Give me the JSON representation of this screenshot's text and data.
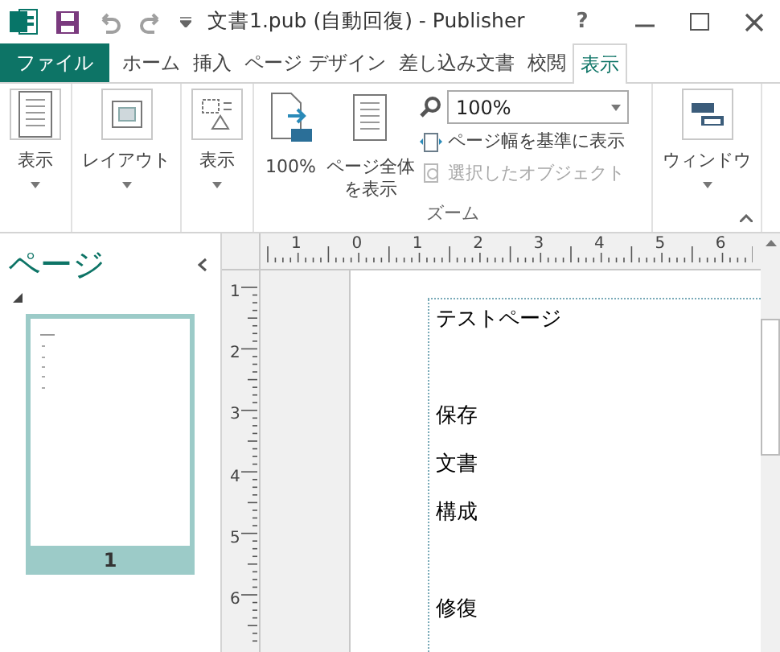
{
  "title_bar": {
    "title": "文書1.pub (自動回復) - Publisher",
    "quick_access": [
      {
        "kind": "save",
        "disabled": false
      },
      {
        "kind": "undo",
        "disabled": true
      },
      {
        "kind": "redo",
        "disabled": true
      }
    ],
    "help": "?"
  },
  "tabs": [
    {
      "label": "ファイル",
      "kind": "file",
      "selected": false
    },
    {
      "label": "ホーム",
      "kind": "tab",
      "selected": false
    },
    {
      "label": "挿入",
      "kind": "tab",
      "selected": false
    },
    {
      "label": "ページ デザイン",
      "kind": "tab",
      "selected": false
    },
    {
      "label": "差し込み文書",
      "kind": "tab",
      "selected": false
    },
    {
      "label": "校閲",
      "kind": "tab",
      "selected": false
    },
    {
      "label": "表示",
      "kind": "tab",
      "selected": true
    }
  ],
  "ribbon": {
    "groups": [
      {
        "buttons": [
          {
            "label": "表示",
            "kind": "page"
          }
        ]
      },
      {
        "buttons": [
          {
            "label": "レイアウト",
            "kind": "picture"
          }
        ]
      },
      {
        "buttons": [
          {
            "label": "表示",
            "kind": "shapes"
          }
        ]
      },
      {
        "label": "ズーム",
        "zoom": {
          "value": "100%",
          "large": [
            {
              "label": "100%",
              "kind": "hundred"
            },
            {
              "label": "ページ全体を表示",
              "kind": "page"
            }
          ],
          "small": [
            {
              "label": "ページ幅を基準に表示",
              "disabled": false
            },
            {
              "label": "選択したオブジェクト",
              "disabled": true
            }
          ]
        }
      },
      {
        "buttons": [
          {
            "label": "ウィンドウ",
            "kind": "windows"
          }
        ]
      }
    ]
  },
  "page_pane": {
    "title": "ページ",
    "pages": [
      {
        "number": "1",
        "selected": true
      }
    ]
  },
  "horizontal_ruler": [
    "1",
    "0",
    "1",
    "2",
    "3",
    "4",
    "5",
    "6"
  ],
  "vertical_ruler": [
    "1",
    "2",
    "3",
    "4",
    "5",
    "6"
  ],
  "document": {
    "lines": [
      {
        "kind": "text",
        "text": "テストページ"
      },
      {
        "kind": "blank"
      },
      {
        "kind": "text",
        "text": "保存"
      },
      {
        "kind": "text",
        "text": "文書"
      },
      {
        "kind": "text",
        "text": "構成"
      },
      {
        "kind": "blank"
      },
      {
        "kind": "text",
        "text": "修復"
      }
    ]
  }
}
